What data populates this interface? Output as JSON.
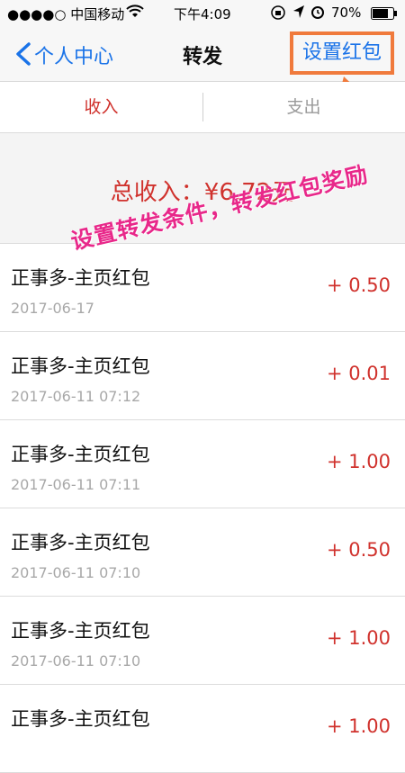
{
  "status_bar": {
    "carrier": "●●●●○ 中国移动",
    "time": "下午4:09",
    "battery": "70%"
  },
  "nav": {
    "back_label": "个人中心",
    "title": "转发",
    "action_label": "设置红包"
  },
  "tabs": [
    {
      "label": "收入"
    },
    {
      "label": "支出"
    }
  ],
  "summary": {
    "total_income": "总收入：¥6.72元"
  },
  "overlay_annotation": "设置转发条件，转发红包奖励",
  "items": [
    {
      "title": "正事多-主页红包",
      "date": "2017-06-17",
      "amount": "+ 0.50"
    },
    {
      "title": "正事多-主页红包",
      "date": "2017-06-11 07:12",
      "amount": "+ 0.01"
    },
    {
      "title": "正事多-主页红包",
      "date": "2017-06-11 07:11",
      "amount": "+ 1.00"
    },
    {
      "title": "正事多-主页红包",
      "date": "2017-06-11 07:10",
      "amount": "+ 0.50"
    },
    {
      "title": "正事多-主页红包",
      "date": "2017-06-11 07:10",
      "amount": "+ 1.00"
    },
    {
      "title": "正事多-主页红包",
      "date": "",
      "amount": "+ 1.00"
    }
  ],
  "colors": {
    "accent_blue": "#1a73e8",
    "income_red": "#d0322d",
    "highlight_orange": "#f07a3c",
    "annotation_pink": "#e8288a"
  }
}
